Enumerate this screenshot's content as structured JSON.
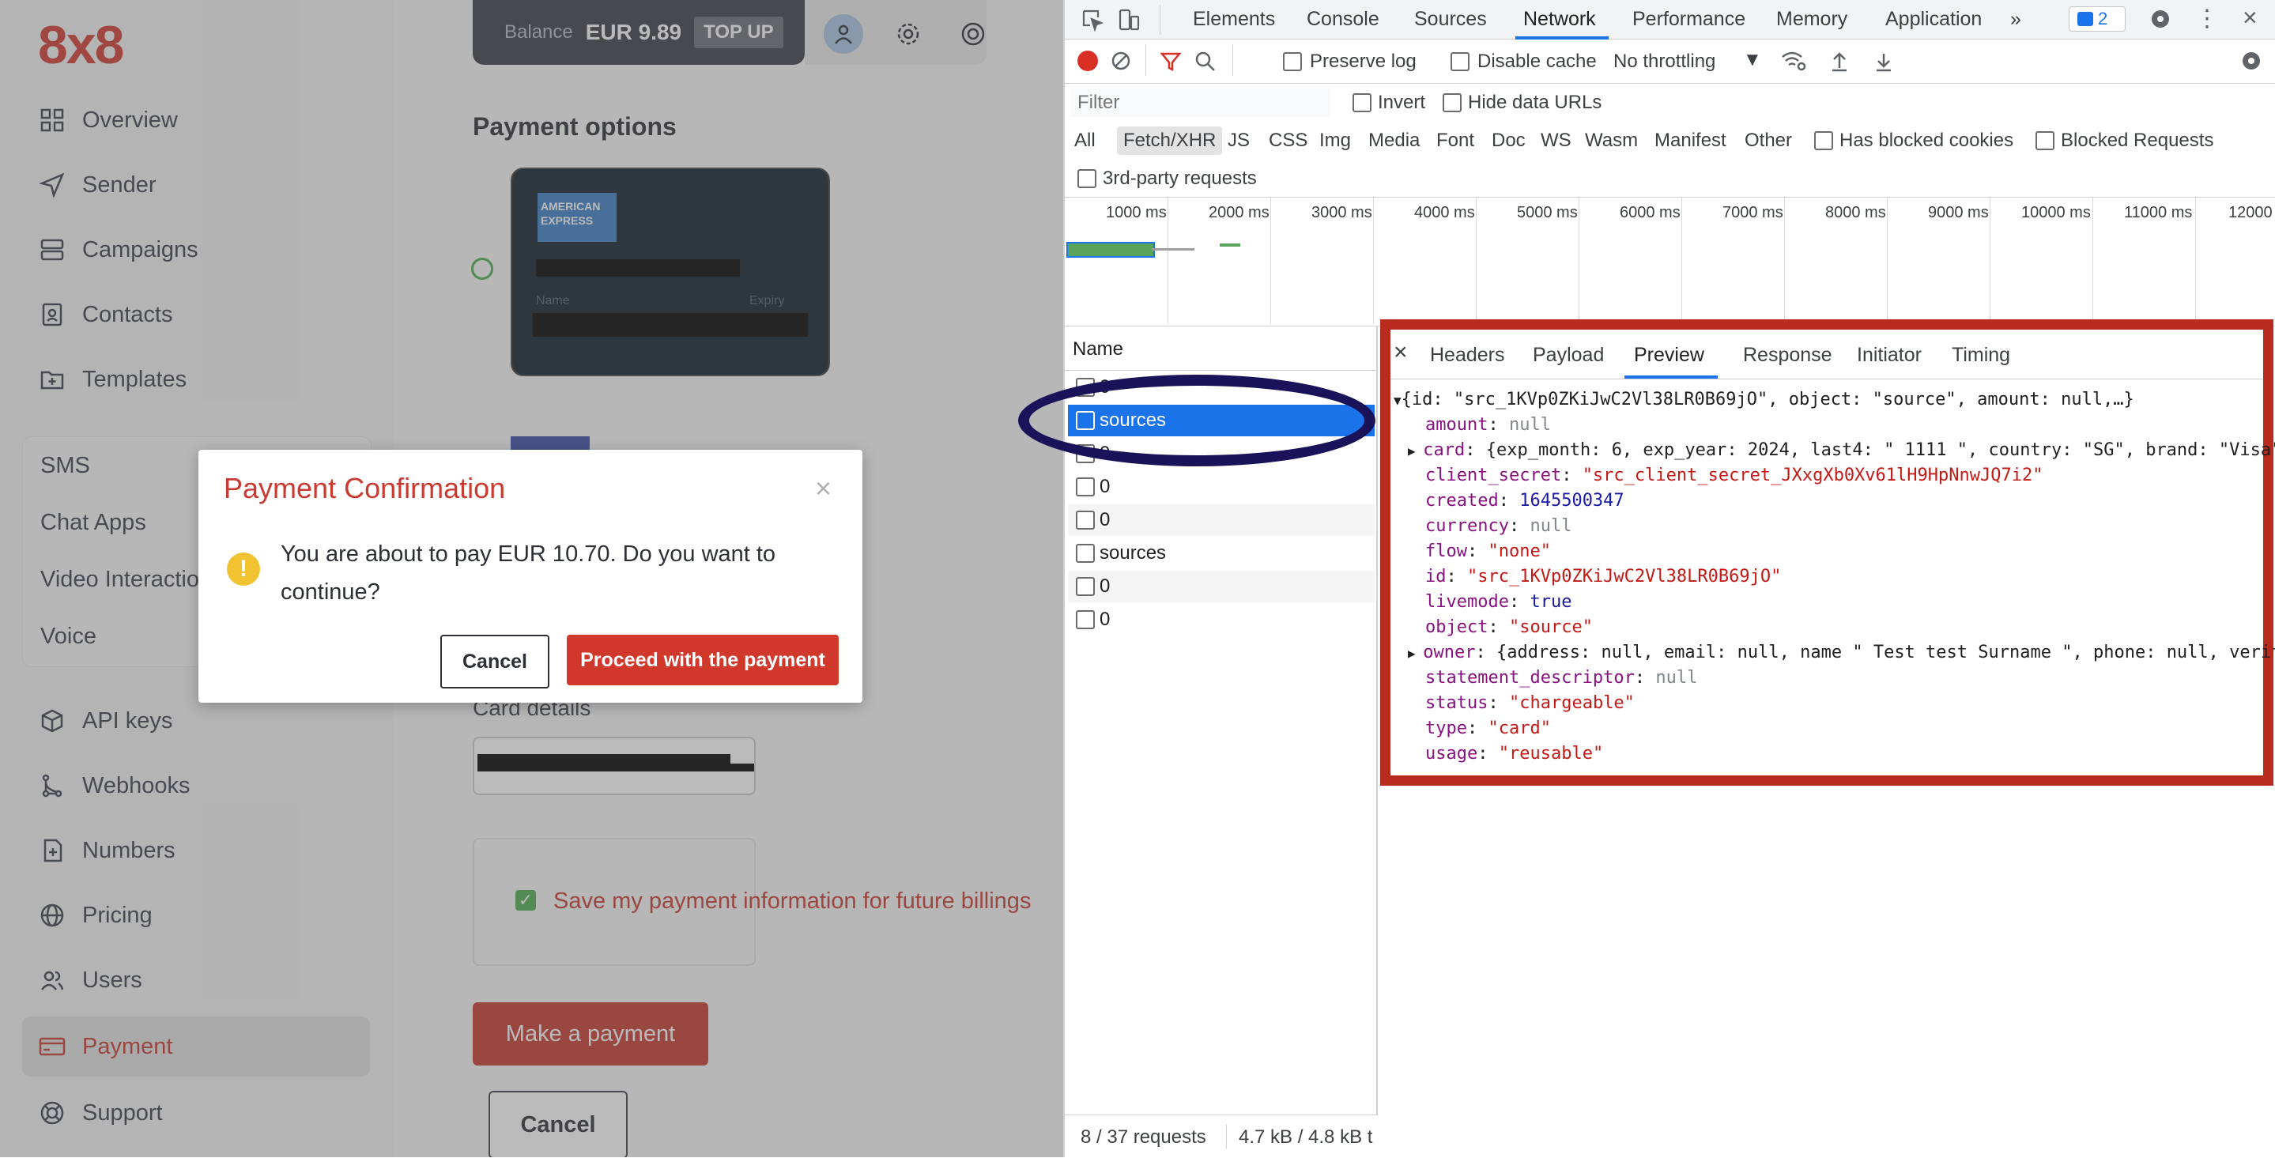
{
  "app": {
    "logo": "8x8",
    "nav_top": [
      {
        "label": "Overview",
        "icon": "grid-icon"
      },
      {
        "label": "Sender",
        "icon": "send-icon"
      },
      {
        "label": "Campaigns",
        "icon": "campaigns-icon"
      },
      {
        "label": "Contacts",
        "icon": "contacts-icon"
      },
      {
        "label": "Templates",
        "icon": "templates-icon"
      }
    ],
    "channels": [
      "SMS",
      "Chat Apps",
      "Video Interactions",
      "Voice"
    ],
    "nav_bottom": [
      {
        "label": "API keys",
        "icon": "cube-icon"
      },
      {
        "label": "Webhooks",
        "icon": "webhooks-icon"
      },
      {
        "label": "Numbers",
        "icon": "numbers-icon"
      },
      {
        "label": "Pricing",
        "icon": "globe-icon"
      },
      {
        "label": "Users",
        "icon": "users-icon"
      },
      {
        "label": "Payment",
        "icon": "card-icon",
        "active": true
      },
      {
        "label": "Support",
        "icon": "support-icon"
      }
    ],
    "balance": {
      "label": "Balance",
      "value": "EUR 9.89",
      "topup": "TOP UP"
    },
    "payment_options_title": "Payment options",
    "card": {
      "brand": "AMERICAN EXPRESS",
      "name_label": "Name",
      "expiry_label": "Expiry"
    },
    "card_details_label": "Card details",
    "save_label": "Save my payment information for future billings",
    "make_payment": "Make a payment",
    "cancel": "Cancel",
    "colors": {
      "brand": "#c93a31",
      "dark": "#3b3d45",
      "success": "#4caf50"
    }
  },
  "modal": {
    "title": "Payment Confirmation",
    "close": "×",
    "message": "You are about to pay EUR 10.70. Do you want to continue?",
    "cancel": "Cancel",
    "proceed": "Proceed with the payment"
  },
  "devtools": {
    "tabs": [
      "Elements",
      "Console",
      "Sources",
      "Network",
      "Performance",
      "Memory",
      "Application"
    ],
    "active_tab": "Network",
    "more": "»",
    "issues_count": "2",
    "toolbar": {
      "preserve_log": "Preserve log",
      "disable_cache": "Disable cache",
      "throttling": "No throttling"
    },
    "filter_placeholder": "Filter",
    "invert": "Invert",
    "hide_data_urls": "Hide data URLs",
    "type_filters": [
      "All",
      "Fetch/XHR",
      "JS",
      "CSS",
      "Img",
      "Media",
      "Font",
      "Doc",
      "WS",
      "Wasm",
      "Manifest",
      "Other"
    ],
    "has_blocked_cookies": "Has blocked cookies",
    "blocked_requests": "Blocked Requests",
    "third_party": "3rd-party requests",
    "timeline_ticks": [
      "1000 ms",
      "2000 ms",
      "3000 ms",
      "4000 ms",
      "5000 ms",
      "6000 ms",
      "7000 ms",
      "8000 ms",
      "9000 ms",
      "10000 ms",
      "11000 ms",
      "12000"
    ],
    "name_header": "Name",
    "requests": [
      "0",
      "sources",
      "0",
      "0",
      "0",
      "sources",
      "0",
      "0"
    ],
    "status_bar": {
      "requests": "8 / 37 requests",
      "size": "4.7 kB / 4.8 kB t"
    },
    "detail_tabs": [
      "Headers",
      "Payload",
      "Preview",
      "Response",
      "Initiator",
      "Timing"
    ],
    "active_detail_tab": "Preview",
    "preview": {
      "summary": "{id: \"src_1KVp0ZKiJwC2Vl38LR0B69jO\", object: \"source\", amount: null,…}",
      "amount": "null",
      "card": "{exp_month: 6, exp_year: 2024, last4: \" 1111 \", country: \"SG\", brand: \"Visa\"",
      "client_secret": "\"src_client_secret_JXxgXb0Xv61lH9HpNnwJQ7i2\"",
      "created": "1645500347",
      "currency": "null",
      "flow": "\"none\"",
      "id": "\"src_1KVp0ZKiJwC2Vl38LR0B69jO\"",
      "livemode": "true",
      "object": "\"source\"",
      "owner": "{address: null, email: null, name  \" Test test Surname \", phone: null, verif",
      "statement_descriptor": "null",
      "status": "\"chargeable\"",
      "type": "\"card\"",
      "usage": "\"reusable\""
    }
  }
}
